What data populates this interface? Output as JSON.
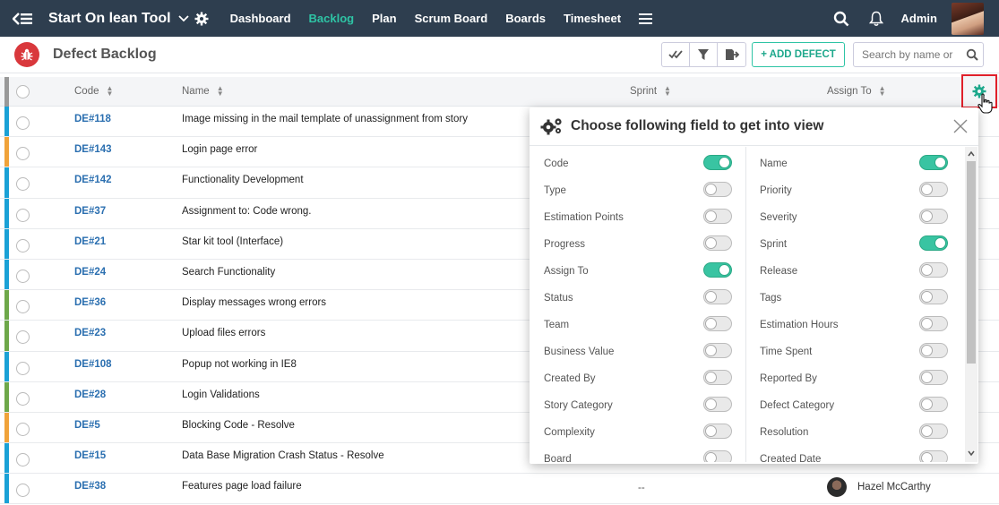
{
  "header": {
    "app_title": "Start On lean Tool",
    "nav": [
      "Dashboard",
      "Backlog",
      "Plan",
      "Scrum Board",
      "Boards",
      "Timesheet"
    ],
    "active_nav": "Backlog",
    "user": "Admin"
  },
  "subheader": {
    "title": "Defect Backlog",
    "add_label": "+ ADD DEFECT",
    "search_placeholder": "Search by name or"
  },
  "table": {
    "columns": {
      "code": "Code",
      "name": "Name",
      "sprint": "Sprint",
      "assign_to": "Assign To"
    },
    "rows": [
      {
        "code": "DE#118",
        "name": "Image missing in the mail template of unassignment from story",
        "color": "#1aa1d6"
      },
      {
        "code": "DE#143",
        "name": "Login page error",
        "color": "#f0a33a"
      },
      {
        "code": "DE#142",
        "name": "Functionality Development",
        "color": "#1aa1d6"
      },
      {
        "code": "DE#37",
        "name": "Assignment to: Code wrong.",
        "color": "#1aa1d6"
      },
      {
        "code": "DE#21",
        "name": "Star kit tool (Interface)",
        "color": "#1aa1d6"
      },
      {
        "code": "DE#24",
        "name": "Search Functionality",
        "color": "#1aa1d6"
      },
      {
        "code": "DE#36",
        "name": "Display messages wrong errors",
        "color": "#6ea84a"
      },
      {
        "code": "DE#23",
        "name": "Upload files errors",
        "color": "#6ea84a"
      },
      {
        "code": "DE#108",
        "name": "Popup not working in IE8",
        "color": "#1aa1d6"
      },
      {
        "code": "DE#28",
        "name": "Login Validations",
        "color": "#6ea84a"
      },
      {
        "code": "DE#5",
        "name": "Blocking Code - Resolve",
        "color": "#f0a33a"
      },
      {
        "code": "DE#15",
        "name": "Data Base Migration Crash Status - Resolve",
        "color": "#1aa1d6"
      },
      {
        "code": "DE#38",
        "name": "Features page load failure",
        "color": "#1aa1d6",
        "sprint": "--",
        "assignee": "Hazel McCarthy"
      }
    ]
  },
  "popup": {
    "title": "Choose following field to get into view",
    "left_fields": [
      {
        "label": "Code",
        "on": true
      },
      {
        "label": "Type",
        "on": false
      },
      {
        "label": "Estimation Points",
        "on": false
      },
      {
        "label": "Progress",
        "on": false
      },
      {
        "label": "Assign To",
        "on": true
      },
      {
        "label": "Status",
        "on": false
      },
      {
        "label": "Team",
        "on": false
      },
      {
        "label": "Business Value",
        "on": false
      },
      {
        "label": "Created By",
        "on": false
      },
      {
        "label": "Story Category",
        "on": false
      },
      {
        "label": "Complexity",
        "on": false
      },
      {
        "label": "Board",
        "on": false
      }
    ],
    "right_fields": [
      {
        "label": "Name",
        "on": true
      },
      {
        "label": "Priority",
        "on": false
      },
      {
        "label": "Severity",
        "on": false
      },
      {
        "label": "Sprint",
        "on": true
      },
      {
        "label": "Release",
        "on": false
      },
      {
        "label": "Tags",
        "on": false
      },
      {
        "label": "Estimation Hours",
        "on": false
      },
      {
        "label": "Time Spent",
        "on": false
      },
      {
        "label": "Reported By",
        "on": false
      },
      {
        "label": "Defect Category",
        "on": false
      },
      {
        "label": "Resolution",
        "on": false
      },
      {
        "label": "Created Date",
        "on": false
      }
    ]
  },
  "colors": {
    "accent": "#2ec4a5",
    "topbar": "#2e3e4f",
    "link": "#2b6fb0",
    "highlight": "#e0202a"
  },
  "icons": [
    "menu-back-icon",
    "chevron-down-icon",
    "gear-icon",
    "search-icon",
    "bell-icon",
    "bug-icon",
    "check-all-icon",
    "filter-icon",
    "export-icon",
    "close-icon",
    "hand-cursor-icon"
  ]
}
